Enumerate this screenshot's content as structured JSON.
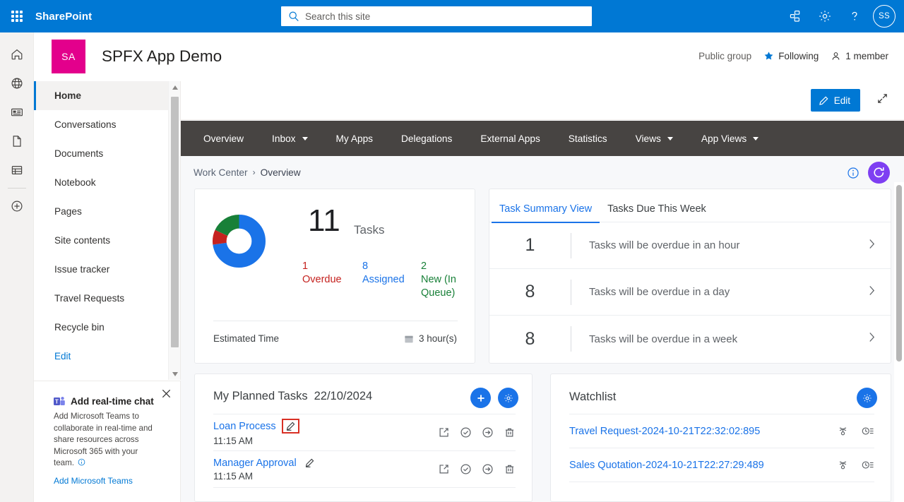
{
  "suite": {
    "waffle_icon": "app-launcher-icon",
    "brand": "SharePoint",
    "search_placeholder": "Search this site",
    "search_value": "",
    "search_icon": "search-icon",
    "icons": [
      {
        "name": "diagram-icon",
        "label": "SharePoint app bar"
      },
      {
        "name": "gear-icon",
        "label": "Settings"
      },
      {
        "name": "help-icon",
        "label": "Help"
      }
    ],
    "avatar_initials": "SS"
  },
  "rail": {
    "items": [
      {
        "name": "home-icon",
        "label": "Home"
      },
      {
        "name": "globe-icon",
        "label": "My sites"
      },
      {
        "name": "news-icon",
        "label": "News"
      },
      {
        "name": "document-icon",
        "label": "Files"
      },
      {
        "name": "list-icon",
        "label": "Lists"
      },
      {
        "name": "plus-icon",
        "label": "Create"
      }
    ]
  },
  "site": {
    "logo_initials": "SA",
    "title": "SPFX App Demo",
    "privacy": "Public group",
    "following_label": "Following",
    "following_icon": "star-icon",
    "members_label": "1 member",
    "members_icon": "person-icon"
  },
  "site_nav": {
    "items": [
      {
        "label": "Home",
        "selected": true
      },
      {
        "label": "Conversations",
        "selected": false
      },
      {
        "label": "Documents",
        "selected": false
      },
      {
        "label": "Notebook",
        "selected": false
      },
      {
        "label": "Pages",
        "selected": false
      },
      {
        "label": "Site contents",
        "selected": false
      },
      {
        "label": "Issue tracker",
        "selected": false
      },
      {
        "label": "Travel Requests",
        "selected": false
      },
      {
        "label": "Recycle bin",
        "selected": false
      }
    ],
    "edit_label": "Edit"
  },
  "promo": {
    "icon": "teams-icon",
    "title": "Add real-time chat",
    "body": "Add Microsoft Teams to collaborate in real-time and share resources across Microsoft 365 with your team.",
    "info_icon": "info-icon",
    "link": "Add Microsoft Teams",
    "close_icon": "close-icon"
  },
  "command_bar": {
    "edit_label": "Edit",
    "edit_icon": "pencil-icon",
    "expand_icon": "expand-icon"
  },
  "webpart_nav": {
    "tabs": [
      {
        "label": "Overview",
        "has_caret": false
      },
      {
        "label": "Inbox",
        "has_caret": true
      },
      {
        "label": "My Apps",
        "has_caret": false
      },
      {
        "label": "Delegations",
        "has_caret": false
      },
      {
        "label": "External Apps",
        "has_caret": false
      },
      {
        "label": "Statistics",
        "has_caret": false
      },
      {
        "label": "Views",
        "has_caret": true
      },
      {
        "label": "App Views",
        "has_caret": true
      }
    ]
  },
  "breadcrumb": {
    "root": "Work Center",
    "separator": "›",
    "current": "Overview",
    "info_icon": "info-circle-icon",
    "refresh_icon": "refresh-icon",
    "refresh_color": "#7e3ff2"
  },
  "task_overview": {
    "count": "11",
    "count_label": "Tasks",
    "stats": [
      {
        "value": "1",
        "label": "Overdue",
        "color": "#c5221f"
      },
      {
        "value": "8",
        "label": "Assigned",
        "color": "#1a73e8"
      },
      {
        "value": "2",
        "label": "New (In Queue)",
        "color": "#188038"
      }
    ],
    "estimated_time_label": "Estimated Time",
    "estimated_time_value": "3 hour(s)",
    "estimated_time_icon": "calendar-icon"
  },
  "chart_data": {
    "type": "pie",
    "title": "Task status breakdown",
    "categories": [
      "Overdue",
      "Assigned",
      "New (In Queue)"
    ],
    "values": [
      1,
      8,
      2
    ],
    "colors": [
      "#c5221f",
      "#1a73e8",
      "#188038"
    ],
    "total": 11,
    "total_label": "Tasks",
    "donut": true,
    "inner_radius_ratio": 0.52,
    "legend": "inline-below",
    "grid": false
  },
  "summary_panel": {
    "tabs": [
      {
        "label": "Task Summary View",
        "active": true
      },
      {
        "label": "Tasks Due This Week",
        "active": false
      }
    ],
    "rows": [
      {
        "count": "1",
        "text": "Tasks will be overdue in an hour",
        "chevron": "chevron-right-icon"
      },
      {
        "count": "8",
        "text": "Tasks will be overdue in a day",
        "chevron": "chevron-right-icon"
      },
      {
        "count": "8",
        "text": "Tasks will be overdue in a week",
        "chevron": "chevron-right-icon"
      }
    ]
  },
  "planned_tasks": {
    "title": "My Planned Tasks",
    "date": "22/10/2024",
    "add_icon": "plus-icon",
    "settings_icon": "gear-icon",
    "rows": [
      {
        "name": "Loan Process",
        "time": "11:15 AM",
        "edit_icon": "pencil-icon",
        "highlighted": true
      },
      {
        "name": "Manager Approval",
        "time": "11:15 AM",
        "edit_icon": "pencil-icon",
        "highlighted": false
      }
    ],
    "actions": [
      {
        "name": "open-in-new-icon"
      },
      {
        "name": "check-circle-icon"
      },
      {
        "name": "forward-circle-icon"
      },
      {
        "name": "trash-icon"
      }
    ]
  },
  "watchlist": {
    "title": "Watchlist",
    "settings_icon": "gear-icon",
    "rows": [
      {
        "label": "Travel Request-2024-10-21T22:32:02:895"
      },
      {
        "label": "Sales Quotation-2024-10-21T22:27:29:489"
      }
    ],
    "actions": [
      {
        "name": "workflow-icon"
      },
      {
        "name": "history-icon"
      }
    ]
  }
}
